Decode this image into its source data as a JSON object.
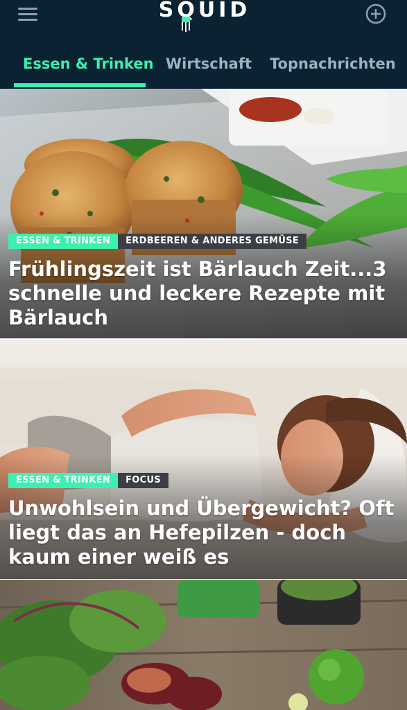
{
  "app": {
    "logo_text": "SQUID"
  },
  "icons": {
    "menu": "hamburger-menu-icon",
    "add": "plus-circle-icon",
    "logo_mark": "squid-icon"
  },
  "colors": {
    "header_bg": "#0b2233",
    "accent": "#3df0b0",
    "tab_inactive": "#9fb0be",
    "secondary_tag": "#3b3f45"
  },
  "tabs": [
    {
      "label": "Essen & Trinken",
      "active": true
    },
    {
      "label": "Wirtschaft",
      "active": false
    },
    {
      "label": "Topnachrichten",
      "active": false
    }
  ],
  "articles": [
    {
      "tags": [
        "ESSEN & TRINKEN",
        "ERDBEEREN & ANDERES GEMÜSE"
      ],
      "title": "Frühlingszeit ist Bärlauch Zeit...3 schnelle und leckere Rezepte mit Bärlauch"
    },
    {
      "tags": [
        "ESSEN & TRINKEN",
        "FOCUS"
      ],
      "title": "Unwohlsein und Übergewicht? Oft liegt das an Hefepilzen - doch kaum einer weiß es"
    },
    {
      "tags": [],
      "title": ""
    }
  ]
}
